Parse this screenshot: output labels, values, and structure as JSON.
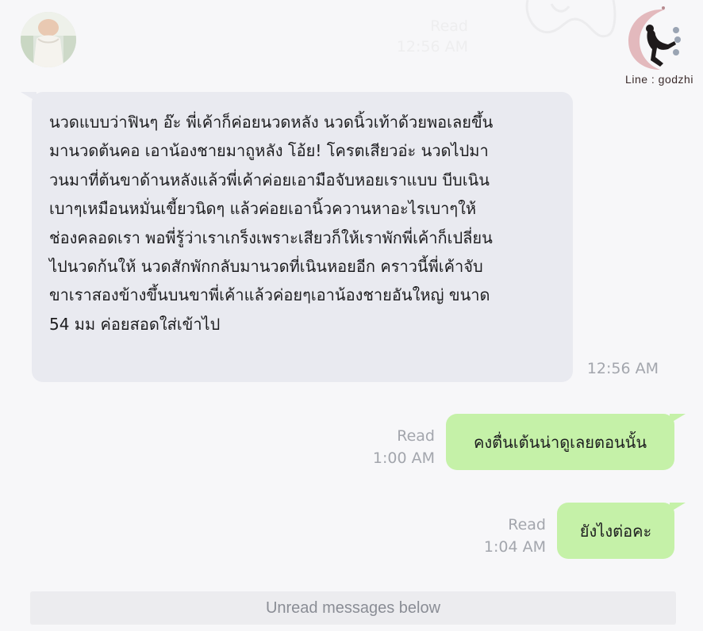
{
  "previous_message": {
    "status": "Read",
    "time": "12:56 AM"
  },
  "watermark": {
    "label": "Line : godzhi"
  },
  "messages": [
    {
      "direction": "incoming",
      "lines": [
        "นวดแบบว่าฟินๆ อ๊ะ พี่เค้าก็ค่อยนวดหลัง นวดนิ้วเท้าด้วยพอเลยขึ้น",
        "มานวดต้นคอ เอาน้องชายมาถูหลัง โอ้ย! โครตเสียวอ่ะ นวดไปมา",
        "วนมาที่ต้นขาด้านหลังแล้วพี่เค้าค่อยเอามือจับหอยเราแบบ บีบเนิน",
        "เบาๆเหมือนหมั่นเขี้ยวนิดๆ แล้วค่อยเอานิ้วควานหาอะไรเบาๆให้",
        "ช่องคลอดเรา พอพี่รู้ว่าเราเกร็งเพราะเสียวก็ให้เราพักพี่เค้าก็เปลี่ยน",
        "ไปนวดก้นให้ นวดสักพักกลับมานวดที่เนินหอยอีก คราวนี้พี่เค้าจับ",
        "ขาเราสองข้างขึ้นบนขาพี่เค้าแล้วค่อยๆเอาน้องชายอันใหญ่ ขนาด",
        "54 มม ค่อยสอดใส่เข้าไป"
      ],
      "time": "12:56 AM"
    },
    {
      "direction": "outgoing",
      "text": "คงตื่นเต้นน่าดูเลยตอนนั้น",
      "status": "Read",
      "time": "1:00 AM"
    },
    {
      "direction": "outgoing",
      "text": "ยังไงต่อคะ",
      "status": "Read",
      "time": "1:04 AM"
    }
  ],
  "unread_banner": "Unread messages below",
  "colors": {
    "background": "#f7f7f9",
    "incoming_bubble": "#e9eaf0",
    "outgoing_bubble": "#c5f1a8",
    "meta_text": "#a3a6ad",
    "unread_bar": "#ececef"
  }
}
